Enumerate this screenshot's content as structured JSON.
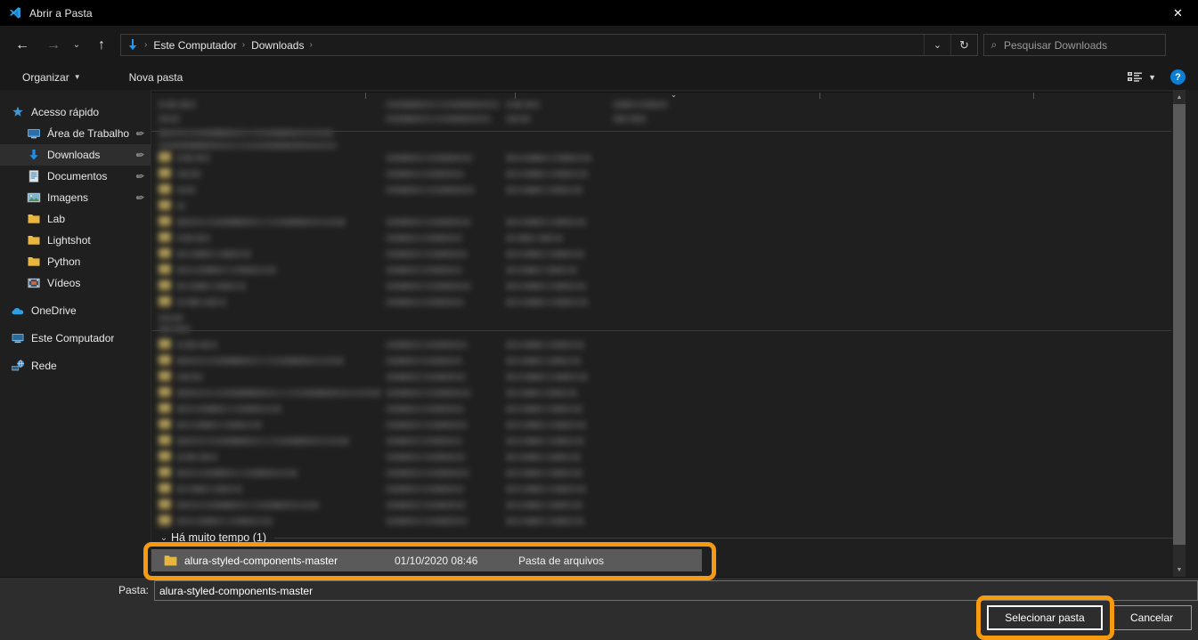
{
  "window": {
    "title": "Abrir a Pasta",
    "app_icon": "vscode-logo-icon",
    "close_label": "✕"
  },
  "navbar": {
    "back_icon": "←",
    "forward_icon": "→",
    "history_icon": "⌄",
    "up_icon": "↑",
    "breadcrumb_icon": "downloads-arrow-icon",
    "breadcrumbs": [
      "Este Computador",
      "Downloads"
    ],
    "separator": "›",
    "dropdown_icon": "⌄",
    "refresh_icon": "↻",
    "search": {
      "icon": "⌕",
      "placeholder": "Pesquisar Downloads",
      "value": ""
    }
  },
  "commandbar": {
    "organize_label": "Organizar",
    "organize_caret": "▼",
    "new_folder_label": "Nova pasta",
    "view_icon": "list-view-icon",
    "view_caret": "▼",
    "help_label": "?"
  },
  "navpane": {
    "items": [
      {
        "label": "Acesso rápido",
        "icon": "star-icon",
        "pinned": false,
        "selected": false,
        "indent": 12,
        "group_top": true
      },
      {
        "label": "Área de Trabalho",
        "icon": "desktop-monitor-icon",
        "pinned": true,
        "selected": false,
        "indent": 30
      },
      {
        "label": "Downloads",
        "icon": "download-arrow-icon",
        "pinned": true,
        "selected": true,
        "indent": 30
      },
      {
        "label": "Documentos",
        "icon": "document-icon",
        "pinned": true,
        "selected": false,
        "indent": 30
      },
      {
        "label": "Imagens",
        "icon": "picture-icon",
        "pinned": true,
        "selected": false,
        "indent": 30
      },
      {
        "label": "Lab",
        "icon": "folder-icon",
        "pinned": false,
        "selected": false,
        "indent": 30
      },
      {
        "label": "Lightshot",
        "icon": "folder-icon",
        "pinned": false,
        "selected": false,
        "indent": 30
      },
      {
        "label": "Python",
        "icon": "folder-icon",
        "pinned": false,
        "selected": false,
        "indent": 30
      },
      {
        "label": "Vídeos",
        "icon": "video-icon",
        "pinned": false,
        "selected": false,
        "indent": 30
      },
      {
        "label": "OneDrive",
        "icon": "cloud-icon",
        "pinned": false,
        "selected": false,
        "indent": 12,
        "gap_before": true
      },
      {
        "label": "Este Computador",
        "icon": "computer-icon",
        "pinned": false,
        "selected": false,
        "indent": 12,
        "gap_before": true
      },
      {
        "label": "Rede",
        "icon": "network-icon",
        "pinned": false,
        "selected": false,
        "indent": 12,
        "gap_before": true
      }
    ],
    "pin_glyph": "✐"
  },
  "filelist": {
    "group_header": {
      "chevron": "⌄",
      "title": "Há muito tempo (1)"
    },
    "sort_marker": "⌄",
    "selected_row": {
      "icon": "folder-icon",
      "name": "alura-styled-components-master",
      "date": "01/10/2020 08:46",
      "type": "Pasta de arquivos"
    },
    "redacted_note": "blurred file entries",
    "scrollbar": {
      "up_arrow": "▲",
      "down_arrow": "▼"
    }
  },
  "footer": {
    "path_label": "Pasta:",
    "path_value": "alura-styled-components-master",
    "select_button": "Selecionar pasta",
    "cancel_button": "Cancelar"
  },
  "colors": {
    "annotation": "#f59a11",
    "accent_blue": "#0a7fd4",
    "folder_yellow": "#d6bf6a",
    "window_bg": "#1f1f1f",
    "titlebar_bg": "#000000",
    "footer_bg": "#2d2d2d",
    "selection_gray": "#5a5a5a"
  }
}
